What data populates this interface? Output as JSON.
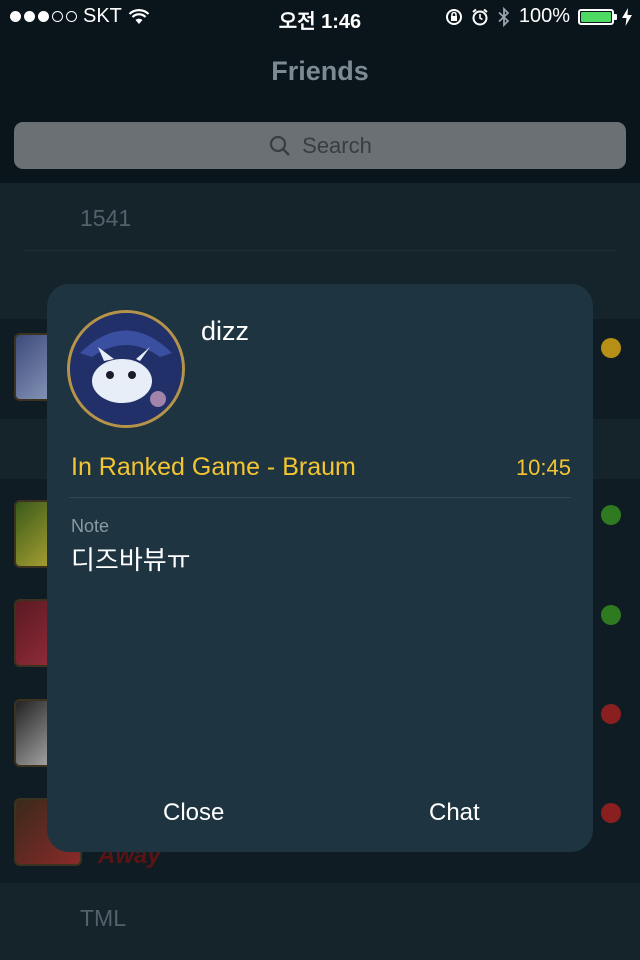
{
  "status_bar": {
    "carrier": "SKT",
    "time": "오전 1:46",
    "battery": "100%",
    "battery_level": 1.0
  },
  "nav": {
    "title": "Friends"
  },
  "search": {
    "placeholder": "Search"
  },
  "list": {
    "sections": [
      "1541",
      "TML"
    ],
    "away_label": "Away"
  },
  "popup": {
    "name": "dizz",
    "status": "In Ranked Game - Braum",
    "time": "10:45",
    "note_label": "Note",
    "note": "디즈바뷰ㅠ",
    "close_label": "Close",
    "chat_label": "Chat"
  },
  "colors": {
    "in_game": "#f4c531",
    "online": "#3d9a2a",
    "busy": "#b02a2a"
  }
}
